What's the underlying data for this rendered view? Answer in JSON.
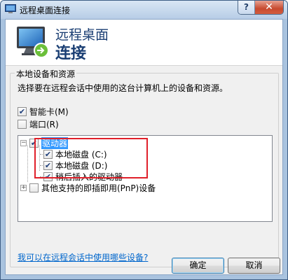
{
  "window": {
    "title": "远程桌面连接",
    "help_glyph": "?",
    "close_glyph": "✕"
  },
  "banner": {
    "line1": "远程桌面",
    "line2": "连接",
    "icon": "remote-desktop-monitor-icon"
  },
  "group": {
    "legend": "本地设备和资源",
    "description": "选择要在远程会话中使用的这台计算机上的设备和资源。"
  },
  "options": [
    {
      "label": "智能卡(M)",
      "checked": true
    },
    {
      "label": "端口(R)",
      "checked": false
    }
  ],
  "tree": {
    "drives": {
      "label": "驱动器",
      "checked": true,
      "expanded": true,
      "selected": true
    },
    "children": [
      {
        "label": "本地磁盘 (C:)",
        "checked": true
      },
      {
        "label": "本地磁盘 (D:)",
        "checked": true
      },
      {
        "label": "稍后插入的驱动器",
        "checked": true
      }
    ],
    "pnp": {
      "label": "其他支持的即插即用(PnP)设备",
      "checked": false,
      "expanded": false
    }
  },
  "link": {
    "label": "我可以在远程会话中使用哪些设备?"
  },
  "buttons": {
    "ok": "确定",
    "cancel": "取消"
  },
  "colors": {
    "accent": "#1a3e73",
    "highlight": "#3399ff",
    "annotation": "#e0202a",
    "link": "#0066cc"
  }
}
